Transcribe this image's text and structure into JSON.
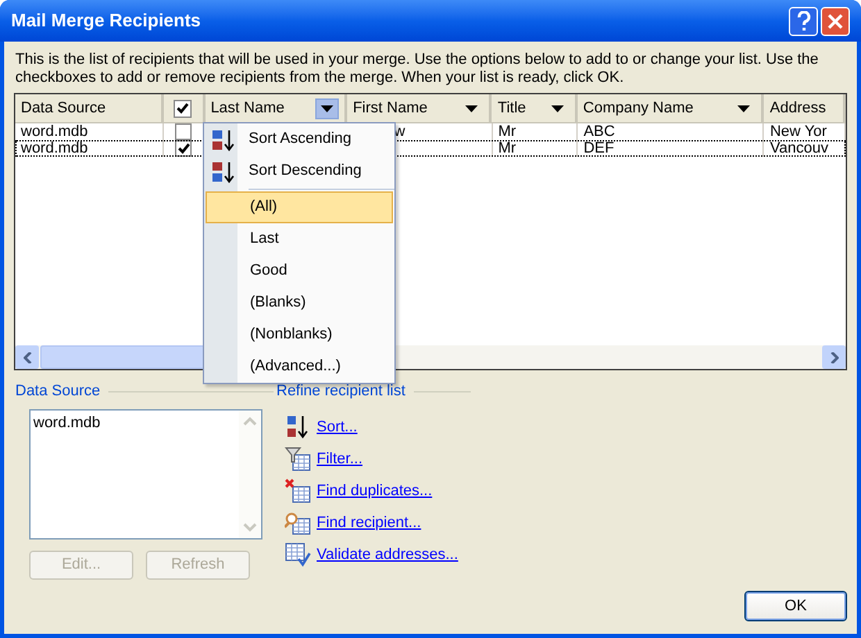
{
  "window": {
    "title": "Mail Merge Recipients"
  },
  "description": "This is the list of recipients that will be used in your merge.  Use the options below to add to or change your list.  Use the checkboxes to add or remove recipients from the merge.  When your list is ready, click OK.",
  "table": {
    "columns": [
      {
        "kind": "plain",
        "label": "Data Source"
      },
      {
        "kind": "checkbox",
        "checked": true
      },
      {
        "kind": "filter",
        "label": "Last Name",
        "open": true
      },
      {
        "kind": "filter",
        "label": "First Name",
        "open": false
      },
      {
        "kind": "filter",
        "label": "Title",
        "open": false
      },
      {
        "kind": "filter",
        "label": "Company Name",
        "open": false
      },
      {
        "kind": "plain",
        "label": "Address"
      }
    ],
    "rows": [
      {
        "selected": false,
        "checked": false,
        "cells": [
          "word.mdb",
          null,
          "",
          "w",
          "Mr",
          "ABC",
          "New Yor"
        ]
      },
      {
        "selected": true,
        "checked": true,
        "cells": [
          "word.mdb",
          null,
          "",
          "",
          "Mr",
          "DEF",
          "Vancouv"
        ]
      }
    ]
  },
  "filter_menu": {
    "sort_items": [
      {
        "kind": "ascending",
        "label": "Sort Ascending"
      },
      {
        "kind": "descending",
        "label": "Sort Descending"
      }
    ],
    "items": [
      {
        "label": "(All)",
        "selected": true
      },
      {
        "label": "Last",
        "selected": false
      },
      {
        "label": "Good",
        "selected": false
      },
      {
        "label": "(Blanks)",
        "selected": false
      },
      {
        "label": "(Nonblanks)",
        "selected": false
      },
      {
        "label": "(Advanced...)",
        "selected": false
      }
    ]
  },
  "data_source": {
    "title": "Data Source",
    "items": [
      "word.mdb"
    ],
    "buttons": [
      {
        "label": "Edit...",
        "disabled": true
      },
      {
        "label": "Refresh",
        "disabled": true
      }
    ]
  },
  "refine": {
    "title": "Refine recipient list",
    "links": [
      {
        "kind": "sort",
        "label": "Sort..."
      },
      {
        "kind": "filter",
        "label": "Filter..."
      },
      {
        "kind": "duplicates",
        "label": "Find duplicates..."
      },
      {
        "kind": "find",
        "label": "Find recipient..."
      },
      {
        "kind": "validate",
        "label": "Validate addresses..."
      }
    ]
  },
  "ok_button": "OK"
}
